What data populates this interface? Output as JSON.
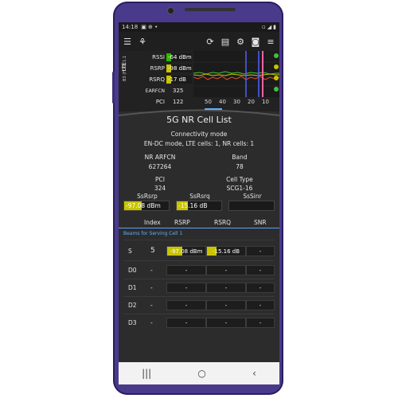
{
  "status_bar": {
    "time": "14:18",
    "icons": [
      "sim-icon",
      "signal-icon",
      "battery-icon"
    ]
  },
  "toolbar": {
    "icons": [
      "menu-icon",
      "app-logo-icon",
      "refresh-icon",
      "list-icon",
      "settings-icon",
      "camera-icon",
      "more-icon"
    ]
  },
  "meters": {
    "side_label": "LTE",
    "band_label": "B3 (FDD) 1.1",
    "rows": [
      {
        "label": "RSSI",
        "value": "-64 dBm",
        "level": 0.82,
        "color": "#2db800"
      },
      {
        "label": "RSRP",
        "value": "-98 dBm",
        "level": 0.45,
        "color": "#c8c400"
      },
      {
        "label": "RSRQ",
        "value": "-17 dB",
        "level": 0.25,
        "color": "#c8c400"
      },
      {
        "label": "EARFCN",
        "value": "325"
      },
      {
        "label": "PCI",
        "value": "122"
      }
    ],
    "graph_axis": [
      "50",
      "40",
      "30",
      "20",
      "10"
    ]
  },
  "cell_panel": {
    "title": "5G NR Cell List",
    "connectivity_label": "Connectivity mode",
    "connectivity_value": "EN-DC mode, LTE cells: 1, NR cells: 1",
    "nr_arfcn_label": "NR ARFCN",
    "nr_arfcn_value": "627264",
    "band_label": "Band",
    "band_value": "78",
    "pci_label": "PCI",
    "pci_value": "324",
    "cell_type_label": "Cell Type",
    "cell_type_value": "SCG1-16",
    "ssrsrp_label": "SsRsrp",
    "ssrsrp_value": "-97.08 dBm",
    "ssrsrp_level": 0.4,
    "ssrsrq_label": "SsRsrq",
    "ssrsrq_value": "-15.16 dB",
    "ssrsrq_level": 0.25,
    "sssinr_label": "SsSinr",
    "sssinr_value": ""
  },
  "table": {
    "headers": [
      "Index",
      "RSRP",
      "RSRQ",
      "SNR"
    ],
    "beams_label": "Beams for Serving Cell 1",
    "rows": [
      {
        "key": "S",
        "index": "5",
        "rsrp": "-97.08 dBm",
        "rsrq": "-15.16 dB",
        "snr": "-",
        "rsrp_level": 0.4,
        "rsrq_level": 0.25
      },
      {
        "key": "D0",
        "index": "-",
        "rsrp": "-",
        "rsrq": "-",
        "snr": "-"
      },
      {
        "key": "D1",
        "index": "-",
        "rsrp": "-",
        "rsrq": "-",
        "snr": "-"
      },
      {
        "key": "D2",
        "index": "-",
        "rsrp": "-",
        "rsrq": "-",
        "snr": "-"
      },
      {
        "key": "D3",
        "index": "-",
        "rsrp": "-",
        "rsrq": "-",
        "snr": "-"
      }
    ]
  },
  "navbar": {
    "icons": [
      "recents-icon",
      "home-icon",
      "back-icon"
    ]
  },
  "colors": {
    "frame": "#4a3a8c",
    "accent_blue": "#5fb0ff",
    "bar_yellow": "#c8c400",
    "bar_green": "#2db800"
  }
}
